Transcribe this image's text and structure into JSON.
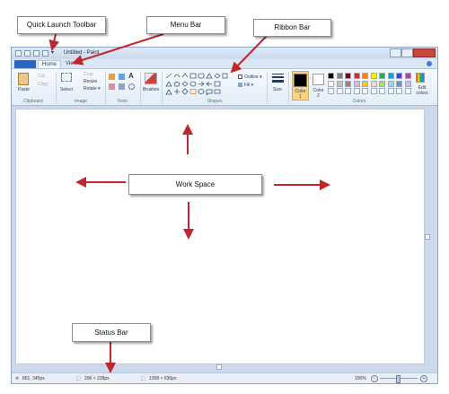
{
  "annotations": {
    "quick_launch_toolbar": "Quick Launch Toolbar",
    "menu_bar": "Menu Bar",
    "ribbon_bar": "Ribbon Bar",
    "work_space": "Work Space",
    "status_bar": "Status Bar"
  },
  "window": {
    "title": "Untitled - Paint"
  },
  "tabs": [
    "Home",
    "View"
  ],
  "ribbon": {
    "clipboard": {
      "paste": "Paste",
      "cut": "Cut",
      "copy": "Copy",
      "group": "Clipboard"
    },
    "image": {
      "select": "Select",
      "crop": "Crop",
      "resize": "Resize",
      "rotate": "Rotate ▾",
      "group": "Image"
    },
    "tools": {
      "group": "Tools"
    },
    "brushes": {
      "label": "Brushes"
    },
    "shapes": {
      "outline": "Outline ▾",
      "fill": "Fill ▾",
      "group": "Shapes"
    },
    "size": {
      "label": "Size"
    },
    "colors": {
      "color1": "Color 1",
      "color2": "Color 2",
      "edit": "Edit colors",
      "group": "Colors",
      "color1_value": "#000000",
      "color2_value": "#ffffff",
      "palette_row1": [
        "#000000",
        "#7f7f7f",
        "#880015",
        "#ed1c24",
        "#ff7f27",
        "#fff200",
        "#22b14c",
        "#00a2e8",
        "#3f48cc",
        "#a349a4"
      ],
      "palette_row2": [
        "#ffffff",
        "#c3c3c3",
        "#b97a57",
        "#ffaec9",
        "#ffc90e",
        "#efe4b0",
        "#b5e61d",
        "#99d9ea",
        "#7092be",
        "#c8bfe7"
      ]
    }
  },
  "status": {
    "cursor": "801, 345px",
    "selection": "206 × 228px",
    "canvas_size": "1008 × 630px",
    "zoom": "100%"
  },
  "colors": {
    "arrow": "#c0262d",
    "ribbon_accent": "#2a67c2"
  }
}
